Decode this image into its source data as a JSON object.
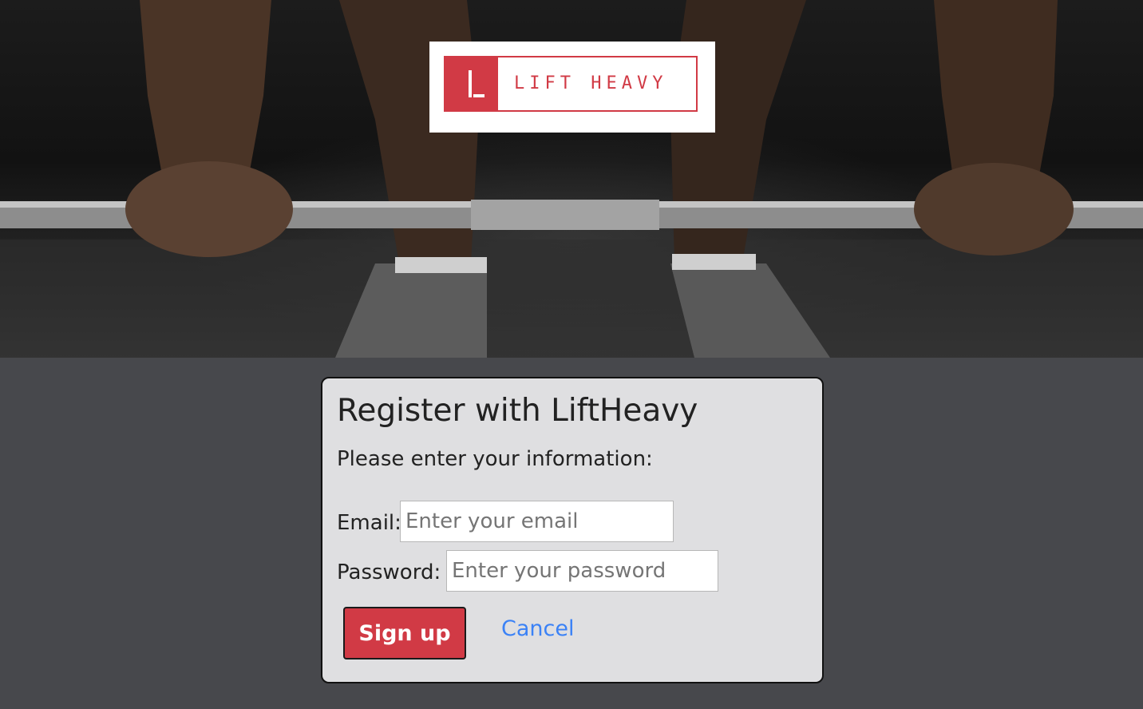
{
  "logo": {
    "text": "LIFT HEAVY",
    "brand_color": "#d13a45"
  },
  "hero": {
    "image_subject": "barbell-lift-photo"
  },
  "form": {
    "title": "Register with LiftHeavy",
    "subtitle": "Please enter your information:",
    "email_label": "Email:",
    "email_placeholder": "Enter your email",
    "email_value": "",
    "password_label": "Password:",
    "password_placeholder": "Enter your password",
    "password_value": "",
    "signup_label": "Sign up",
    "cancel_label": "Cancel"
  },
  "colors": {
    "page_background": "#47484c",
    "card_background": "#dfdfe1",
    "primary_button": "#d13a45",
    "link": "#3b82f6"
  }
}
